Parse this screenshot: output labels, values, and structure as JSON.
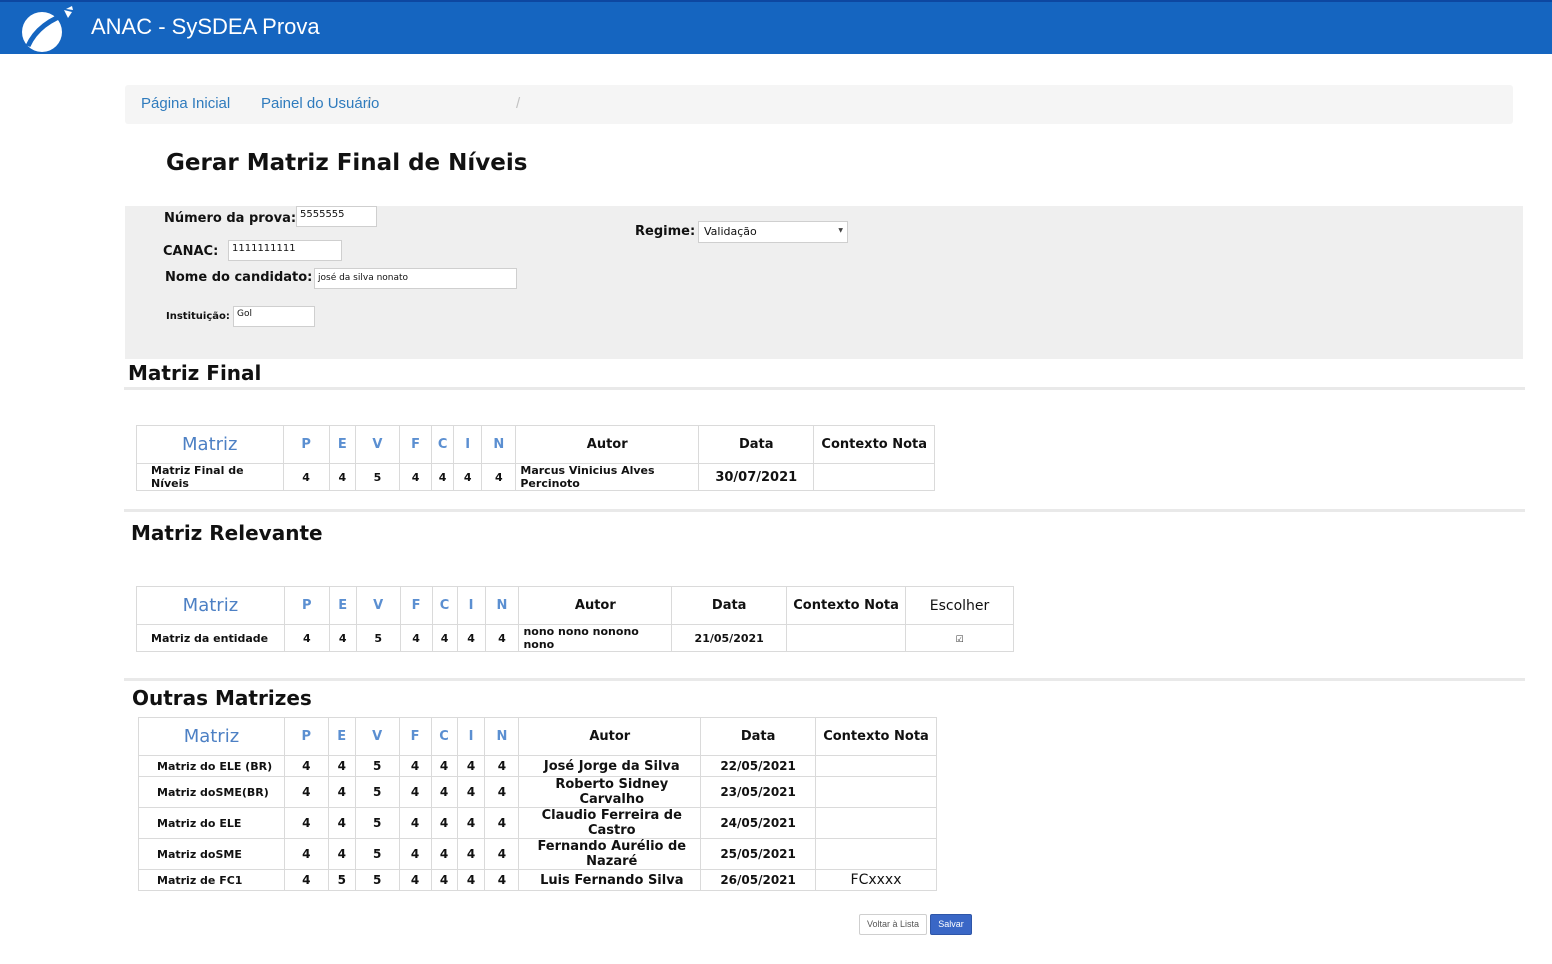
{
  "app": {
    "title": "ANAC - SySDEA Prova",
    "brand_color": "#1565c0",
    "logo_icon": "airplane-orbit-logo"
  },
  "breadcrumb": {
    "items": [
      "Página Inicial",
      "Painel do Usuário"
    ],
    "separator": "/"
  },
  "page_title": "Gerar Matriz Final de Níveis",
  "form": {
    "numero_prova": {
      "label": "Número da prova:",
      "value": "5555555"
    },
    "canac": {
      "label": "CANAC:",
      "value": "1111111111"
    },
    "nome_candidato": {
      "label": "Nome do candidato:",
      "value": "josé da silva nonato"
    },
    "instituicao": {
      "label": "Instituição:",
      "value": "Gol"
    },
    "regime": {
      "label": "Regime:",
      "selected": "Validação"
    }
  },
  "columns": {
    "matriz": "Matriz",
    "letters": [
      "P",
      "E",
      "V",
      "F",
      "C",
      "I",
      "N"
    ],
    "autor": "Autor",
    "data": "Data",
    "contexto_nota": "Contexto Nota",
    "escolher": "Escolher"
  },
  "matriz_final": {
    "title": "Matriz Final",
    "rows": [
      {
        "name": "Matriz Final de Níveis",
        "P": "4",
        "E": "4",
        "V": "5",
        "F": "4",
        "C": "4",
        "I": "4",
        "N": "4",
        "autor": "Marcus Vinicius Alves Percinoto",
        "data": "30/07/2021",
        "contexto": ""
      }
    ]
  },
  "matriz_relevante": {
    "title": "Matriz Relevante",
    "rows": [
      {
        "name": "Matriz da entidade",
        "P": "4",
        "E": "4",
        "V": "5",
        "F": "4",
        "C": "4",
        "I": "4",
        "N": "4",
        "autor": "nono nono nonono nono",
        "data": "21/05/2021",
        "contexto": "",
        "escolher_checked": true
      }
    ]
  },
  "outras_matrizes": {
    "title": "Outras Matrizes",
    "rows": [
      {
        "name": "Matriz do ELE (BR)",
        "P": "4",
        "E": "4",
        "V": "5",
        "F": "4",
        "C": "4",
        "I": "4",
        "N": "4",
        "autor": "José Jorge da Silva",
        "data": "22/05/2021",
        "contexto": ""
      },
      {
        "name": "Matriz doSME(BR)",
        "P": "4",
        "E": "4",
        "V": "5",
        "F": "4",
        "C": "4",
        "I": "4",
        "N": "4",
        "autor": "Roberto Sidney Carvalho",
        "data": "23/05/2021",
        "contexto": ""
      },
      {
        "name": "Matriz do ELE",
        "P": "4",
        "E": "4",
        "V": "5",
        "F": "4",
        "C": "4",
        "I": "4",
        "N": "4",
        "autor": "Claudio Ferreira de Castro",
        "data": "24/05/2021",
        "contexto": ""
      },
      {
        "name": "Matriz doSME",
        "P": "4",
        "E": "4",
        "V": "5",
        "F": "4",
        "C": "4",
        "I": "4",
        "N": "4",
        "autor": "Fernando Aurélio de Nazaré",
        "data": "25/05/2021",
        "contexto": ""
      },
      {
        "name": "Matriz de FC1",
        "P": "4",
        "E": "5",
        "V": "5",
        "F": "4",
        "C": "4",
        "I": "4",
        "N": "4",
        "autor": "Luis Fernando Silva",
        "data": "26/05/2021",
        "contexto": "FCxxxx"
      }
    ]
  },
  "buttons": {
    "voltar": "Voltar à Lista",
    "salvar": "Salvar"
  }
}
